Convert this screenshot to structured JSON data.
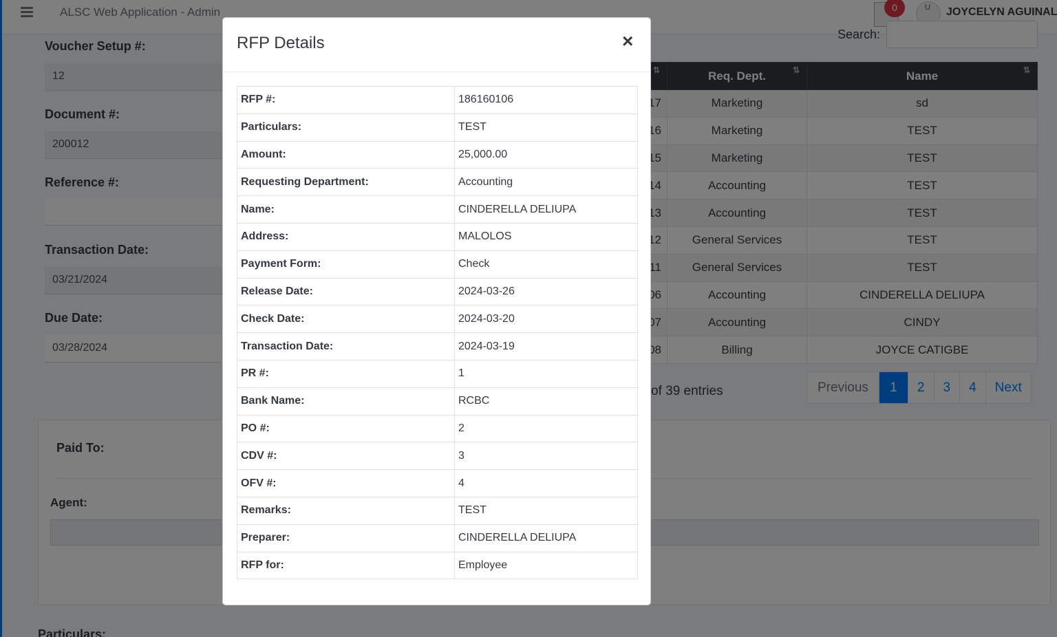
{
  "app": {
    "title": "ALSC Web Application - Admin"
  },
  "header": {
    "notification_count": "0",
    "avatar_alt": "U",
    "user_name": "JOYCELYN AGUINALDO"
  },
  "form": {
    "voucher_setup_label": "Voucher Setup #:",
    "voucher_setup_value": "12",
    "document_label": "Document #:",
    "document_value": "200012",
    "reference_label": "Reference #:",
    "reference_value": "",
    "transaction_date_label": "Transaction Date:",
    "transaction_date_value": "03/21/2024",
    "due_date_label": "Due Date:",
    "due_date_value": "03/28/2024",
    "paid_to_label": "Paid To:",
    "agent_label": "Agent:",
    "particulars_label": "Particulars:"
  },
  "rfp_table": {
    "search_label": "Search:",
    "columns": [
      "Req. Dept.",
      "Name"
    ],
    "rows": [
      {
        "no": "17",
        "dept": "Marketing",
        "name": "sd"
      },
      {
        "no": "16",
        "dept": "Marketing",
        "name": "TEST"
      },
      {
        "no": "15",
        "dept": "Marketing",
        "name": "TEST"
      },
      {
        "no": "14",
        "dept": "Accounting",
        "name": "TEST"
      },
      {
        "no": "13",
        "dept": "Accounting",
        "name": "TEST"
      },
      {
        "no": "12",
        "dept": "General Services",
        "name": "TEST"
      },
      {
        "no": "11",
        "dept": "General Services",
        "name": "TEST"
      },
      {
        "no": "06",
        "dept": "Accounting",
        "name": "CINDERELLA DELIUPA"
      },
      {
        "no": "07",
        "dept": "Accounting",
        "name": "CINDY"
      },
      {
        "no": "08",
        "dept": "Billing",
        "name": "JOYCE CATIGBE"
      }
    ],
    "entries_text": "of 39 entries",
    "pagination": {
      "previous": "Previous",
      "pages": [
        "1",
        "2",
        "3",
        "4"
      ],
      "active_page": "1",
      "next": "Next"
    }
  },
  "modal": {
    "title": "RFP Details",
    "close_label": "×",
    "details": [
      {
        "label": "RFP #:",
        "value": "186160106"
      },
      {
        "label": "Particulars:",
        "value": "TEST"
      },
      {
        "label": "Amount:",
        "value": "25,000.00"
      },
      {
        "label": "Requesting Department:",
        "value": "Accounting"
      },
      {
        "label": "Name:",
        "value": "CINDERELLA DELIUPA"
      },
      {
        "label": "Address:",
        "value": "MALOLOS"
      },
      {
        "label": "Payment Form:",
        "value": "Check"
      },
      {
        "label": "Release Date:",
        "value": "2024-03-26"
      },
      {
        "label": "Check Date:",
        "value": "2024-03-20"
      },
      {
        "label": "Transaction Date:",
        "value": "2024-03-19"
      },
      {
        "label": "PR #:",
        "value": "1"
      },
      {
        "label": "Bank Name:",
        "value": "RCBC"
      },
      {
        "label": "PO #:",
        "value": "2"
      },
      {
        "label": "CDV #:",
        "value": "3"
      },
      {
        "label": "OFV #:",
        "value": "4"
      },
      {
        "label": "Remarks:",
        "value": "TEST"
      },
      {
        "label": "Preparer:",
        "value": "CINDERELLA DELIUPA"
      },
      {
        "label": "RFP for:",
        "value": "Employee"
      }
    ]
  },
  "colors": {
    "primary": "#007bff",
    "table_header": "#343a40",
    "badge": "#dc3545"
  }
}
